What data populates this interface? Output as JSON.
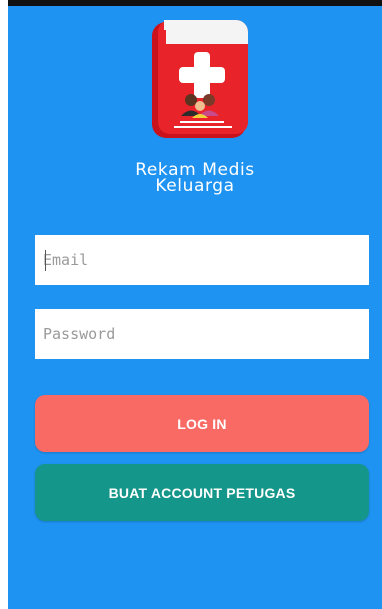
{
  "app": {
    "title_line1": "Rekam Medis",
    "title_line2": "Keluarga"
  },
  "logo": {
    "icon": "medical-record-book-icon"
  },
  "form": {
    "email_placeholder": "Email",
    "password_placeholder": "Password",
    "login_label": "LOG IN",
    "create_account_label": "BUAT ACCOUNT PETUGAS"
  },
  "colors": {
    "background": "#1f93f2",
    "login_button": "#f96a64",
    "create_button": "#15968a",
    "book_red": "#e8232a"
  }
}
